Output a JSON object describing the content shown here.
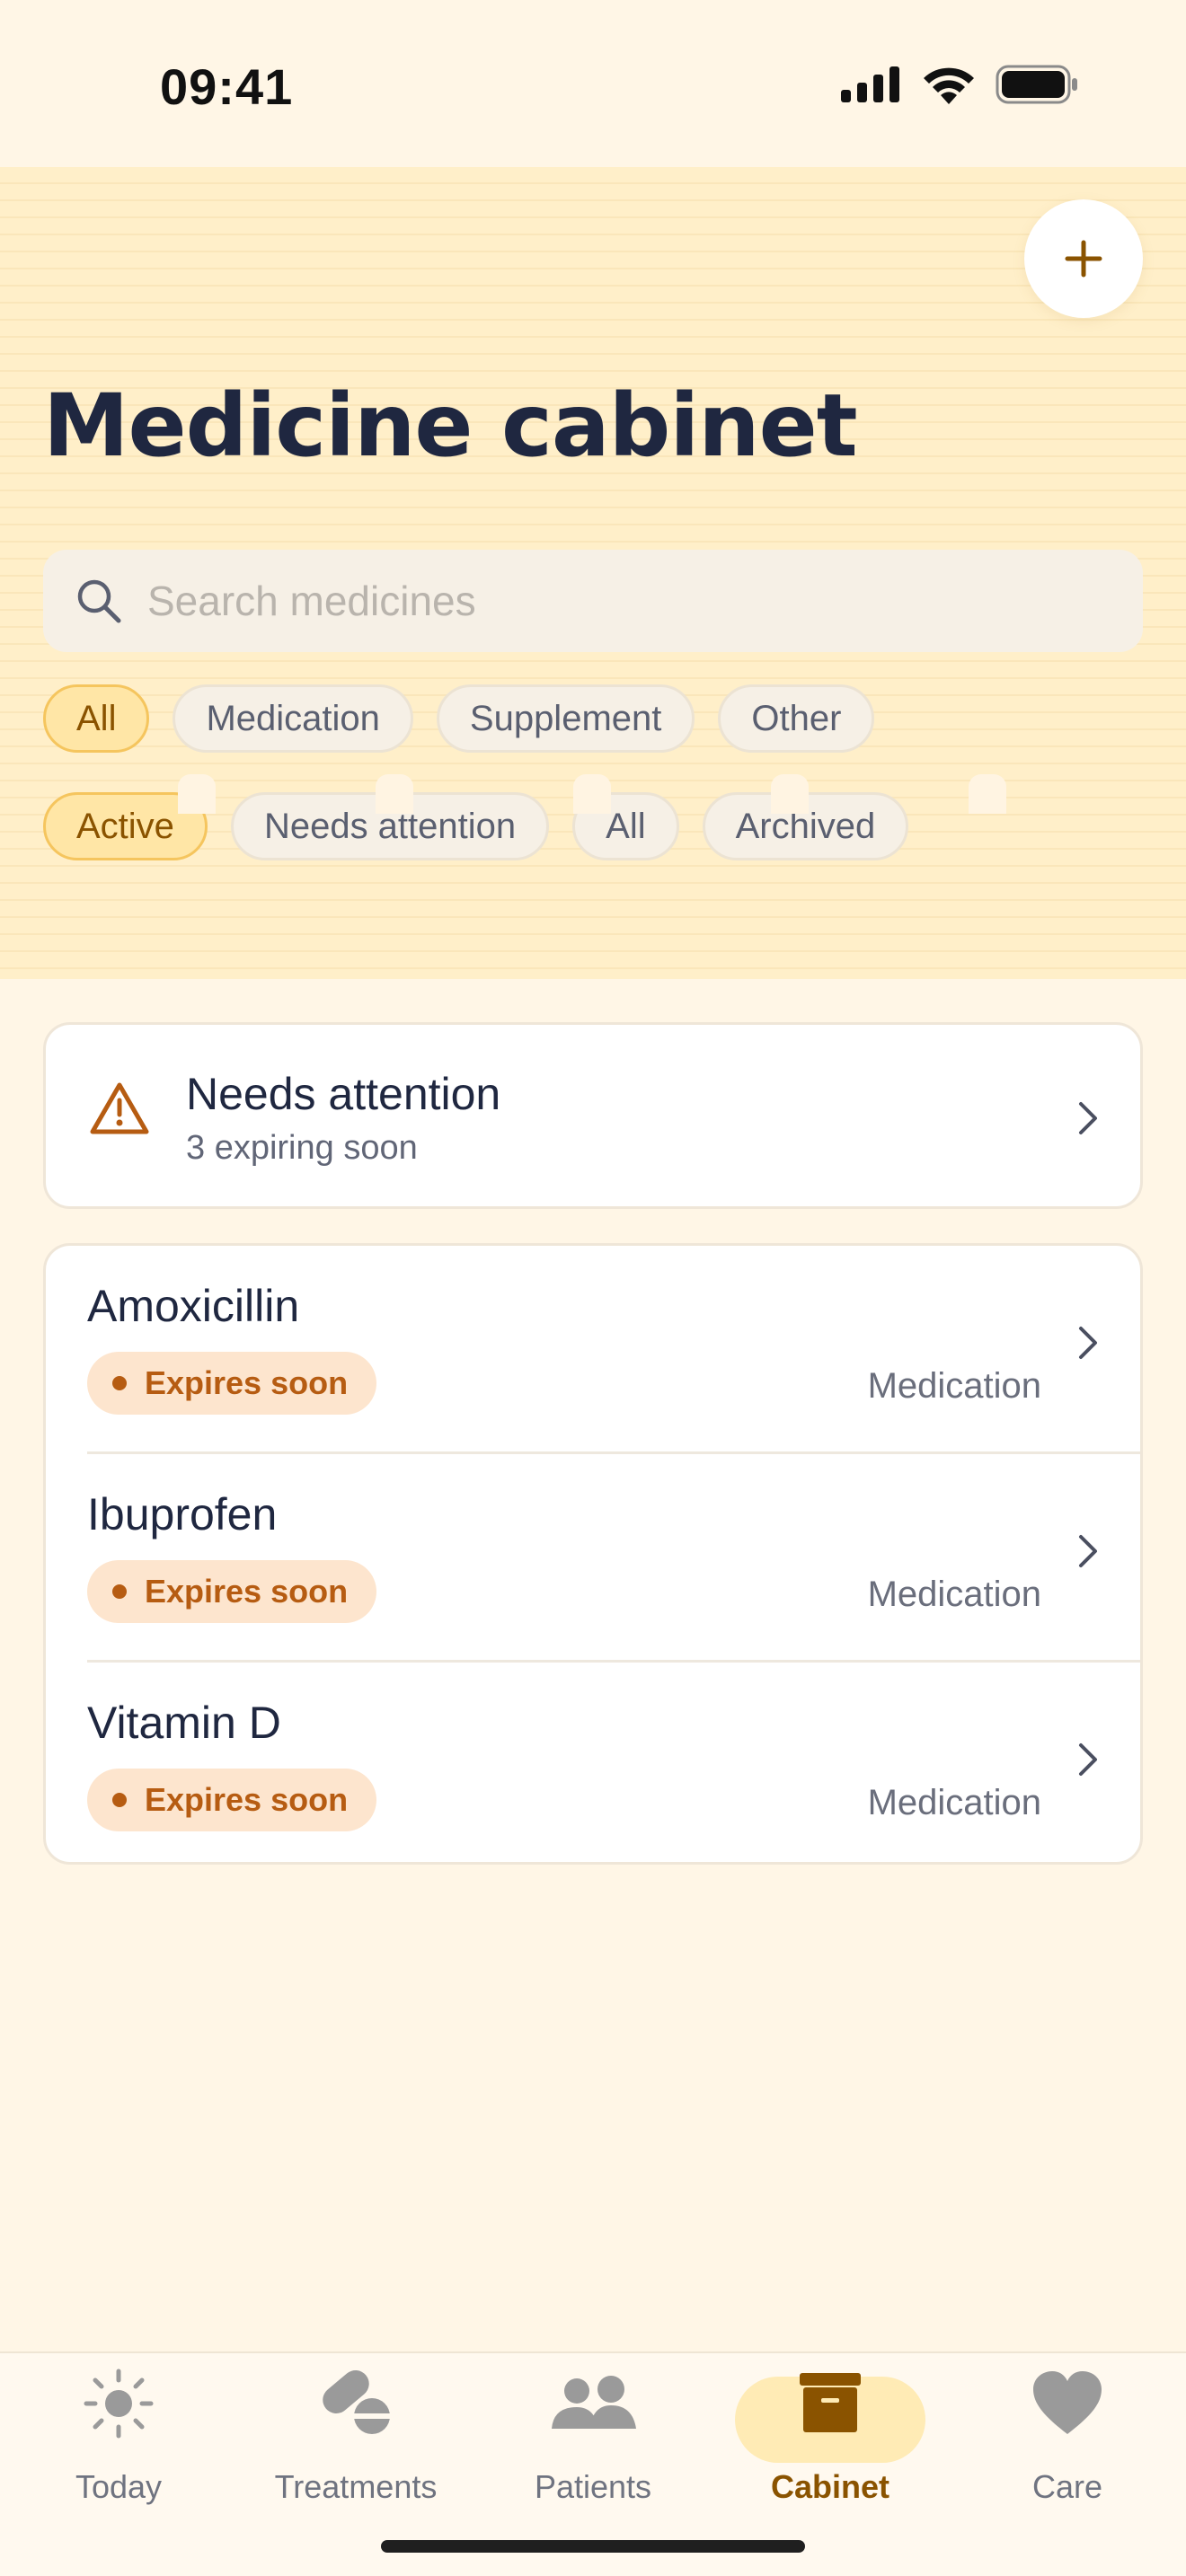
{
  "status_bar": {
    "time": "09:41"
  },
  "header": {
    "title": "Medicine cabinet",
    "add_icon": "plus-icon",
    "search_placeholder": "Search medicines"
  },
  "filters": {
    "type_chips": [
      {
        "label": "All",
        "selected": true
      },
      {
        "label": "Medication",
        "selected": false
      },
      {
        "label": "Supplement",
        "selected": false
      },
      {
        "label": "Other",
        "selected": false
      }
    ],
    "status_chips": [
      {
        "label": "Active",
        "selected": true
      },
      {
        "label": "Needs attention",
        "selected": false
      },
      {
        "label": "All",
        "selected": false
      },
      {
        "label": "Archived",
        "selected": false
      }
    ]
  },
  "attention": {
    "title": "Needs attention",
    "subtitle": "3 expiring soon",
    "icon": "warning-icon"
  },
  "medicines": [
    {
      "name": "Amoxicillin",
      "badge": "Expires soon",
      "category": "Medication"
    },
    {
      "name": "Ibuprofen",
      "badge": "Expires soon",
      "category": "Medication"
    },
    {
      "name": "Vitamin D",
      "badge": "Expires soon",
      "category": "Medication"
    }
  ],
  "tabbar": {
    "tabs": [
      {
        "label": "Today",
        "icon": "sun-icon"
      },
      {
        "label": "Treatments",
        "icon": "pill-icon"
      },
      {
        "label": "Patients",
        "icon": "people-icon"
      },
      {
        "label": "Cabinet",
        "icon": "cabinet-icon",
        "selected": true
      },
      {
        "label": "Care",
        "icon": "heart-icon"
      }
    ]
  },
  "colors": {
    "accent": "#8A5300",
    "warning": "#B65C12",
    "header_bg": "#FFEFC9",
    "page_bg": "#FFF6E6"
  }
}
